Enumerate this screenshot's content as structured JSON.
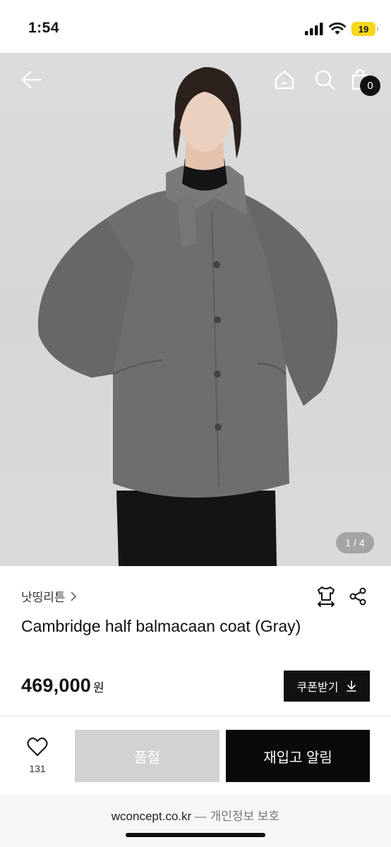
{
  "status_bar": {
    "time": "1:54",
    "battery": "19"
  },
  "hero": {
    "pager": "1 / 4",
    "cart_count": "0"
  },
  "product": {
    "brand": "낫띵리튼",
    "name": "Cambridge half balmacaan coat (Gray)",
    "price": "469,000",
    "price_unit": "원",
    "coupon_label": "쿠폰받기"
  },
  "actions": {
    "like_count": "131",
    "soldout_label": "품절",
    "restock_label": "재입고 알림"
  },
  "browser": {
    "domain": "wconcept.co.kr",
    "secure_label": "— 개인정보 보호"
  },
  "icons": [
    "back-arrow-icon",
    "home-icon",
    "search-icon",
    "shopping-bag-icon",
    "chevron-right-icon",
    "size-guide-icon",
    "share-icon",
    "download-icon",
    "heart-icon",
    "signal-icon",
    "wifi-icon"
  ]
}
